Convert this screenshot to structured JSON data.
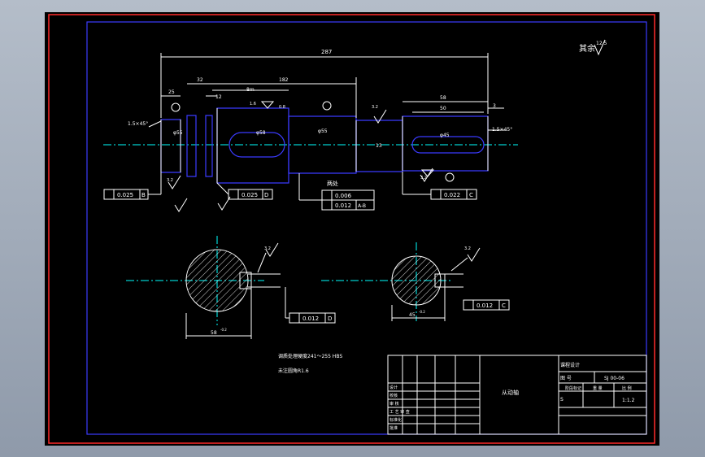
{
  "colors": {
    "frame": "#ff2a2a",
    "border": "#3b3bff",
    "outline": "#3b3bff",
    "centerline": "#00ffff",
    "lines": "#ffffff",
    "background": "#000000",
    "workspace": "#9aa5b4"
  },
  "roughness": {
    "label": "其余",
    "value": "12.5"
  },
  "dims": {
    "overall": "287",
    "d1": "25",
    "d2": "32",
    "d3": "182",
    "d4": "12",
    "d5": "8m",
    "chamfer_left": "1.5×45°",
    "chamfer_right": "1.5×45°",
    "right_len": "58",
    "right_len2": "50",
    "right_gap": "3",
    "inner": "13",
    "bottom": "5",
    "roughness_small": "3.2",
    "roughness_16": "1.6",
    "roughness_08": "0.8"
  },
  "tolerances": {
    "left": {
      "value": "0.025",
      "ref": "B"
    },
    "mid": {
      "value": "0.025",
      "ref": "D"
    },
    "runout1": "0.006",
    "runout2": {
      "value": "0.012",
      "ref": "A-B"
    },
    "right": {
      "value": "0.022",
      "ref": "C"
    },
    "section1": {
      "value": "0.012",
      "ref": "D"
    },
    "section2": {
      "value": "0.012",
      "ref": "C"
    },
    "sec_label": "两处"
  },
  "sections": {
    "s1_dim": "58",
    "s1_depth": "-0.2",
    "s2_dim": "45",
    "s2_depth": "-0.2"
  },
  "notes": {
    "line1": "调质处理硬度241～255  HBS",
    "line2": "未注圆角R1.6"
  },
  "title_block": {
    "part_name": "从动轴",
    "project": "课程设计",
    "drawing_no_label": "图  号",
    "drawing_no": "SJ 00-06",
    "stage_label": "阶段标记",
    "weight_label": "重  量",
    "ratio_label": "比  例",
    "scale": "1:1.2",
    "sheet": "S",
    "rows": [
      "设计",
      "校核",
      "审  核",
      "工  艺 审  查",
      "标准化",
      "批准",
      "日期",
      "日期"
    ]
  }
}
